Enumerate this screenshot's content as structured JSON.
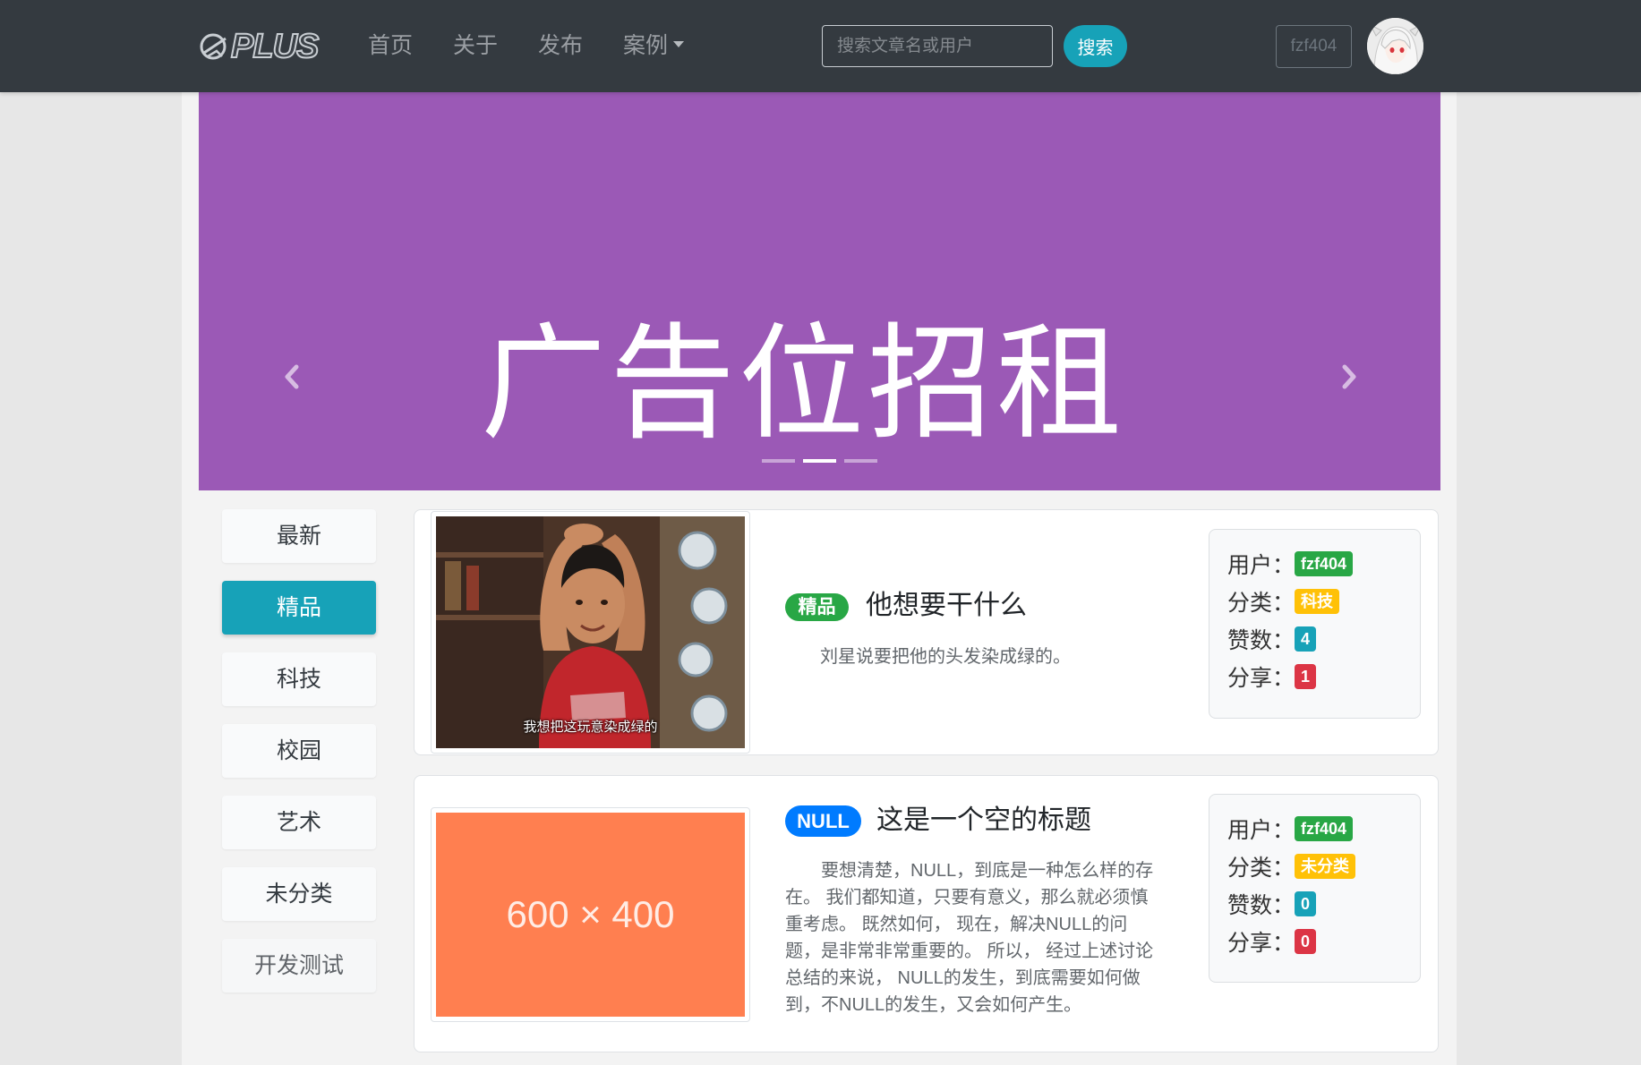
{
  "navbar": {
    "logo_text": "PLUS",
    "links": [
      {
        "label": "首页"
      },
      {
        "label": "关于"
      },
      {
        "label": "发布"
      },
      {
        "label": "案例",
        "dropdown": true
      }
    ],
    "search": {
      "placeholder": "搜索文章名或用户",
      "value": ""
    },
    "search_button": "搜索",
    "user_button": "fzf404",
    "avatar_icon": "avatar-icon"
  },
  "carousel": {
    "text": "广告位招租",
    "background": "#9b59b6",
    "slides": 3,
    "active_slide": 2,
    "prev_icon": "chevron-left-icon",
    "next_icon": "chevron-right-icon"
  },
  "sidebar": {
    "items": [
      "最新",
      "精品",
      "科技",
      "校园",
      "艺术",
      "未分类",
      "开发测试"
    ],
    "active": "精品",
    "active_color": "#17a2b8"
  },
  "posts": [
    {
      "tag": "精品",
      "tag_color": "#28a745",
      "title": "他想要干什么",
      "summary": "刘星说要把他的头发染成绿的。",
      "image_caption": "我想把这玩意染成绿的",
      "info": {
        "user_label": "用户：",
        "user": "fzf404",
        "category_label": "分类：",
        "category": "科技",
        "likes_label": "赞数：",
        "likes": 4,
        "shares_label": "分享：",
        "shares": 1
      }
    },
    {
      "tag": "NULL",
      "tag_color": "#007bff",
      "title": "这是一个空的标题",
      "summary": "要想清楚，NULL，到底是一种怎么样的存在。 我们都知道，只要有意义，那么就必须慎重考虑。 既然如何， 现在，解决NULL的问题，是非常非常重要的。 所以， 经过上述讨论总结的来说， NULL的发生，到底需要如何做到，不NULL的发生，又会如何产生。",
      "image_placeholder": "600 × 400",
      "image_color": "#ff7f50",
      "info": {
        "user_label": "用户：",
        "user": "fzf404",
        "category_label": "分类：",
        "category": "未分类",
        "likes_label": "赞数：",
        "likes": 0,
        "shares_label": "分享：",
        "shares": 0
      }
    }
  ],
  "badge_colors": {
    "user": "#28a745",
    "category": "#ffc107",
    "likes": "#17a2b8",
    "shares": "#dc3545"
  }
}
